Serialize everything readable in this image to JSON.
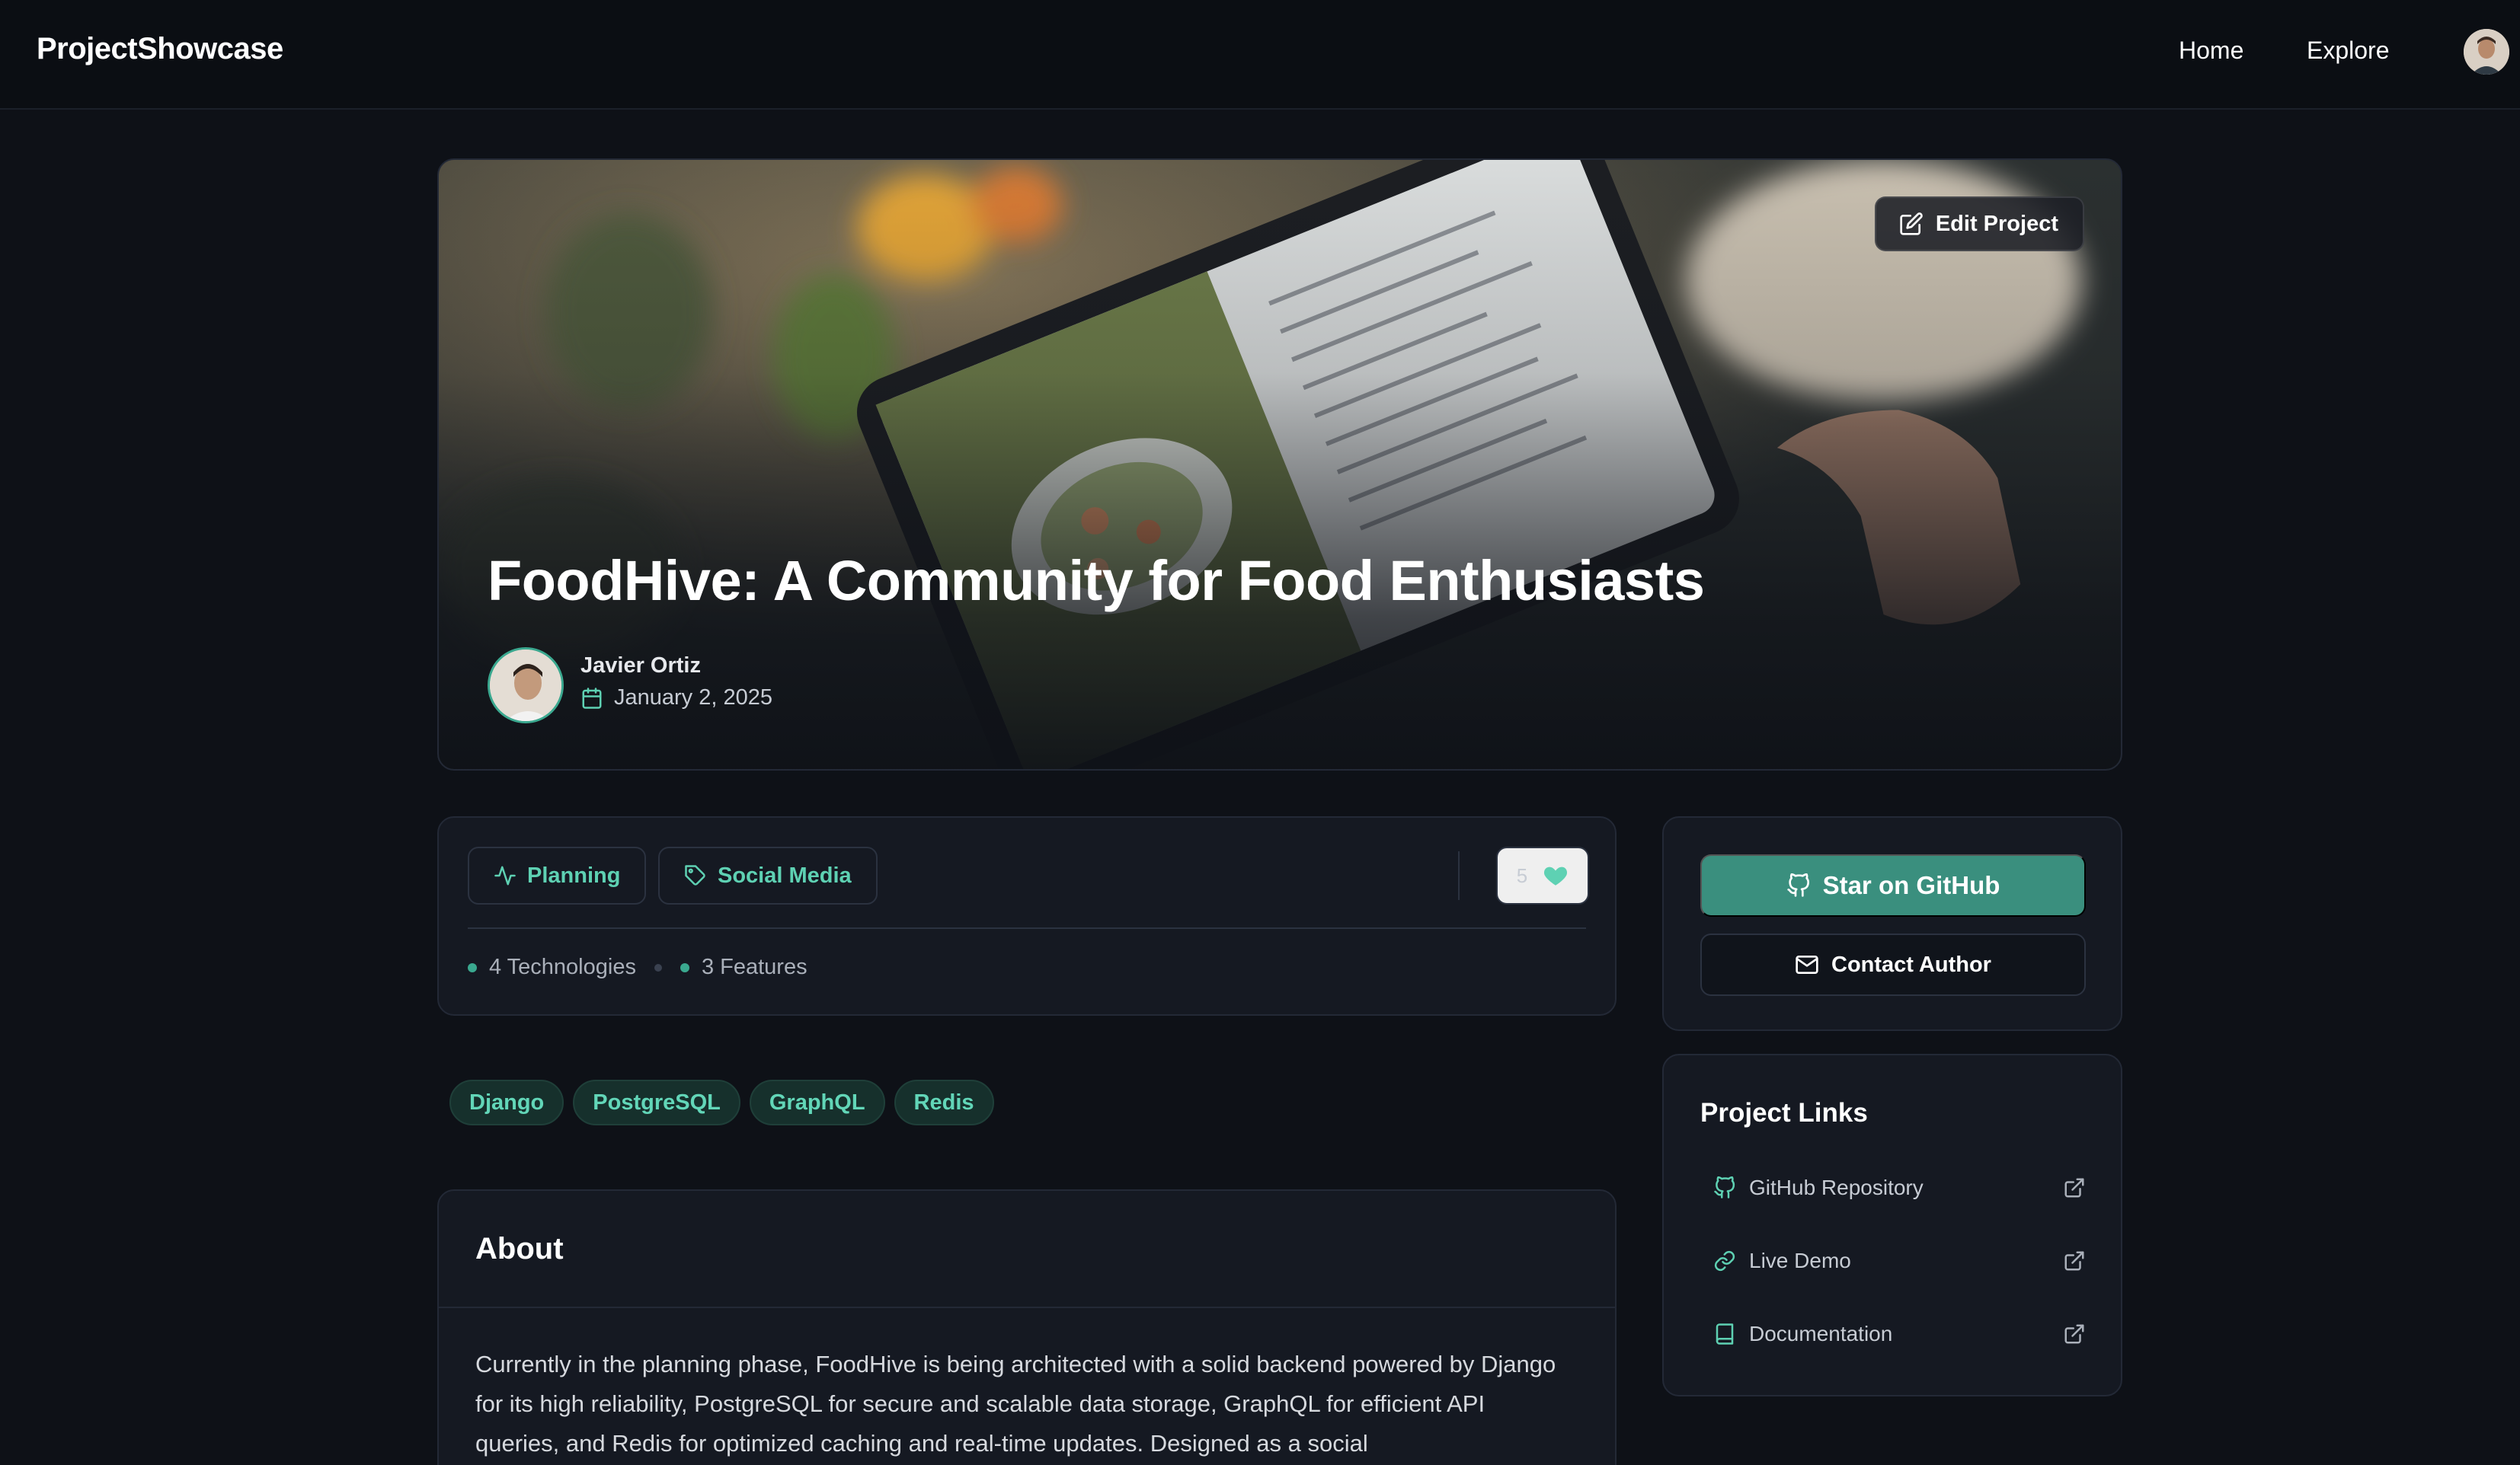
{
  "nav": {
    "brand": "ProjectShowcase",
    "links": [
      "Home",
      "Explore"
    ]
  },
  "hero": {
    "edit_label": "Edit Project",
    "title": "FoodHive: A Community for Food Enthusiasts",
    "author_name": "Javier Ortiz",
    "date": "January 2, 2025"
  },
  "meta": {
    "status_label": "Planning",
    "category_label": "Social Media",
    "likes": "5",
    "technologies": "4 Technologies",
    "features": "3 Features"
  },
  "tech_tags": [
    "Django",
    "PostgreSQL",
    "GraphQL",
    "Redis"
  ],
  "about": {
    "title": "About",
    "text": "Currently in the planning phase, FoodHive is being architected with a solid backend powered by Django for its high reliability, PostgreSQL for secure and scalable data storage, GraphQL for efficient API queries, and Redis for optimized caching and real-time updates. Designed as a social"
  },
  "actions": {
    "star_label": "Star on GitHub",
    "contact_label": "Contact Author"
  },
  "project_links": {
    "title": "Project Links",
    "items": [
      "GitHub Repository",
      "Live Demo",
      "Documentation"
    ]
  },
  "colors": {
    "accent": "#5ed1b3",
    "star_button": "#3a8f7e",
    "background": "#0e1117",
    "card": "#151922"
  }
}
